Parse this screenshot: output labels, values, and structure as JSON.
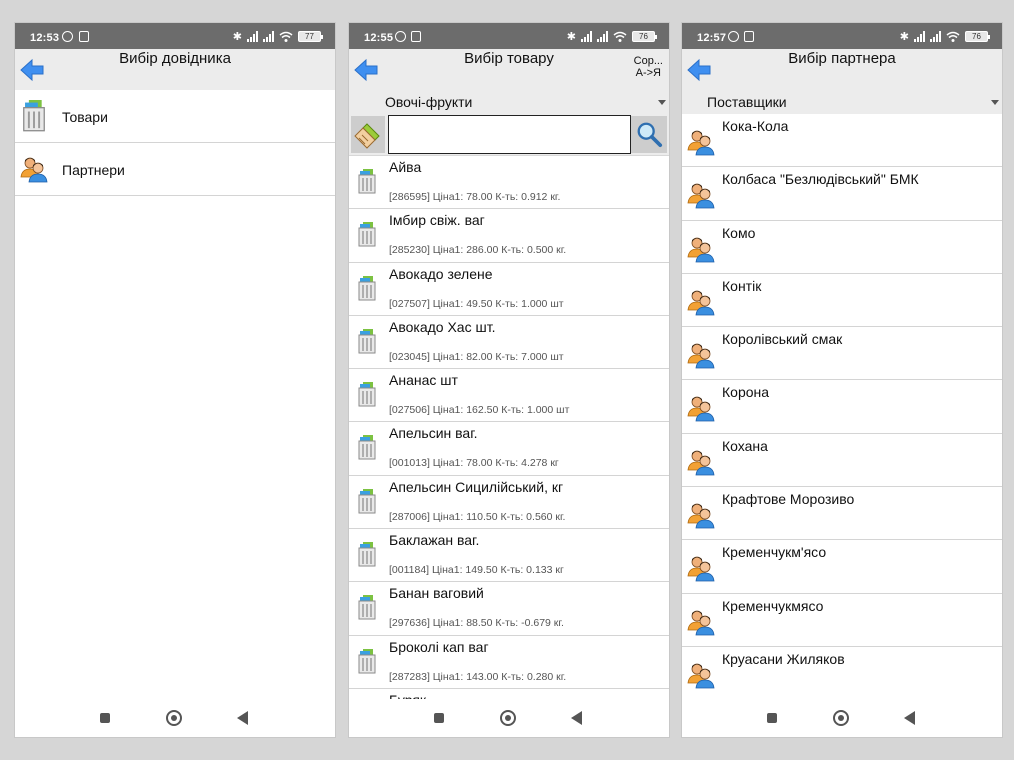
{
  "screens": [
    {
      "status": {
        "time": "12:53",
        "battery": "77"
      },
      "header": {
        "title": "Вибір довідника"
      },
      "menu": [
        {
          "label": "Товари",
          "icon": "product-icon"
        },
        {
          "label": "Партнери",
          "icon": "partner-icon"
        }
      ]
    },
    {
      "status": {
        "time": "12:55",
        "battery": "76"
      },
      "header": {
        "title": "Вибір товару",
        "sort_line1": "Сор...",
        "sort_line2": "А->Я"
      },
      "category": {
        "selected": "Овочі-фрукти"
      },
      "search": {
        "value": ""
      },
      "products": [
        {
          "name": " Айва",
          "info": "[286595] Ціна1: 78.00  К-ть: 0.912 кг."
        },
        {
          "name": "Імбир свіж. ваг",
          "info": "[285230] Ціна1: 286.00  К-ть: 0.500 кг."
        },
        {
          "name": "Авокадо зелене",
          "info": "[027507] Ціна1: 49.50  К-ть: 1.000 шт"
        },
        {
          "name": "Авокадо Хас шт.",
          "info": "[023045] Ціна1: 82.00  К-ть: 7.000 шт"
        },
        {
          "name": "Ананас шт",
          "info": "[027506] Ціна1: 162.50  К-ть: 1.000 шт"
        },
        {
          "name": "Апельсин ваг.",
          "info": "[001013] Ціна1: 78.00  К-ть: 4.278 кг"
        },
        {
          "name": "Апельсин Сицилійський, кг",
          "info": "[287006] Ціна1: 110.50  К-ть: 0.560 кг."
        },
        {
          "name": "Баклажан ваг.",
          "info": "[001184] Ціна1: 149.50  К-ть: 0.133 кг"
        },
        {
          "name": "Банан ваговий",
          "info": "[297636] Ціна1: 88.50  К-ть: -0.679 кг."
        },
        {
          "name": "Броколі кап ваг",
          "info": "[287283] Ціна1: 143.00  К-ть: 0.280 кг."
        },
        {
          "name": "Буряк",
          "info": ""
        }
      ]
    },
    {
      "status": {
        "time": "12:57",
        "battery": "76"
      },
      "header": {
        "title": "Вибір партнера"
      },
      "category": {
        "selected": "Поставщики"
      },
      "partners": [
        "Кока-Кола",
        "Колбаса \"Безлюдівський\" БМК",
        "Комо",
        "Контік",
        "Королівський смак",
        "Корона",
        "Кохана",
        "Крафтове Морозиво",
        "Кременчукм'ясо",
        "Кременчукмясо",
        "Круасани Жиляков"
      ]
    }
  ],
  "colors": {
    "status_bar": "#6c6c6c",
    "header": "#ececec",
    "back_arrow": "#3f8ff0",
    "divider": "#d4d4d4"
  }
}
